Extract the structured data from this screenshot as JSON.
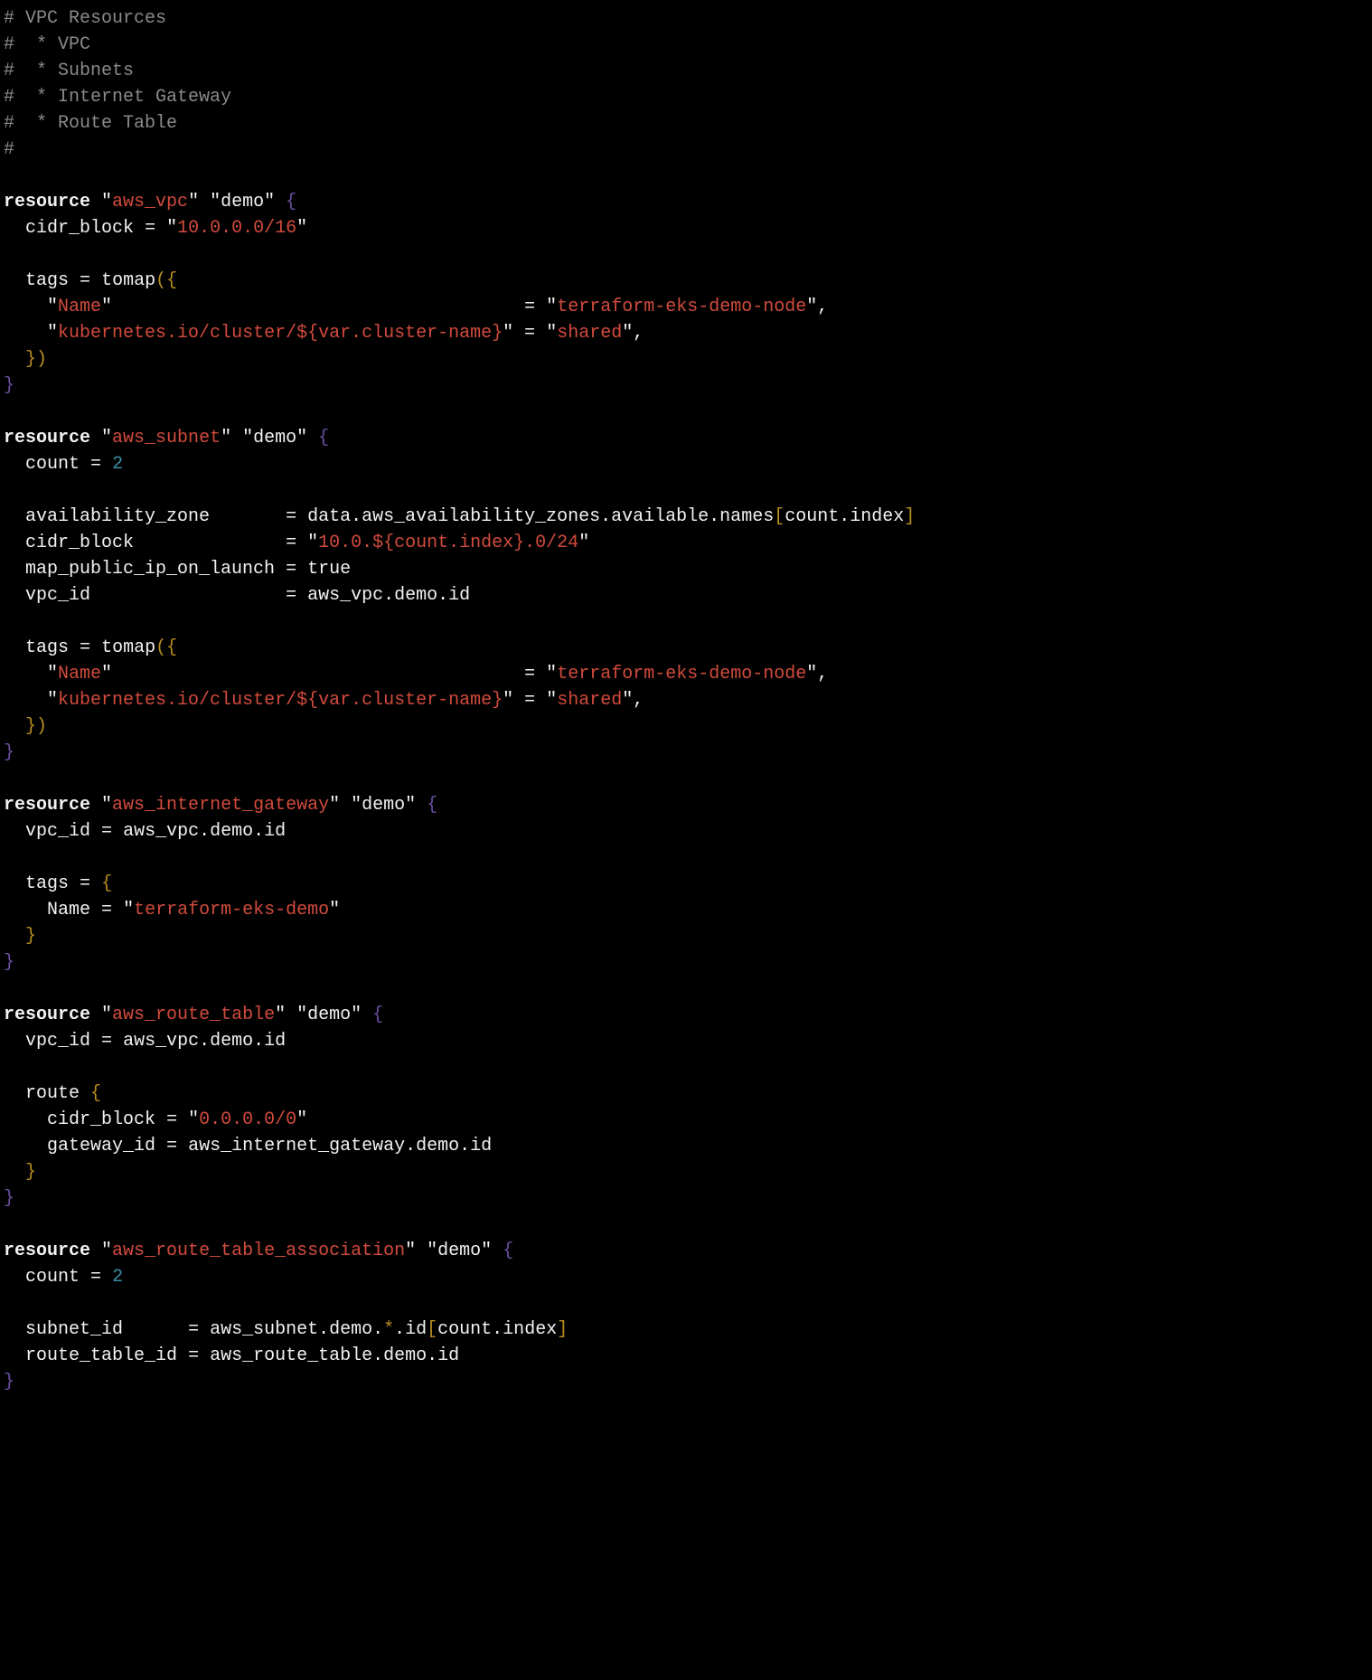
{
  "language": "hcl",
  "file_kind": "terraform",
  "comments": {
    "title": "# VPC Resources",
    "item_vpc": "#  * VPC",
    "item_subnets": "#  * Subnets",
    "item_igw": "#  * Internet Gateway",
    "item_rt": "#  * Route Table",
    "blank": "#"
  },
  "tokens": {
    "resource": "resource",
    "count": "count",
    "tags": "tags",
    "tomap": "tomap",
    "true": "true",
    "data": "data",
    "route": "route"
  },
  "resources": {
    "vpc": {
      "type": "aws_vpc",
      "name": "demo",
      "cidr_block_key": "cidr_block",
      "cidr_block_val": "10.0.0.0/16",
      "tag_name_key": "Name",
      "tag_name_val": "terraform-eks-demo-node",
      "tag_k8s_key_prefix": "kubernetes.io/cluster/",
      "tag_k8s_interp": "${var.cluster-name}",
      "tag_k8s_val": "shared"
    },
    "subnet": {
      "type": "aws_subnet",
      "name": "demo",
      "count_val": "2",
      "az_key": "availability_zone",
      "az_expr_prefix": "data.aws_availability_zones.available.names",
      "az_index": "count.index",
      "cidr_key": "cidr_block",
      "cidr_val_prefix": "10.0.",
      "cidr_val_interp": "${count.index}",
      "cidr_val_suffix": ".0/24",
      "mapip_key": "map_public_ip_on_launch",
      "vpcid_key": "vpc_id",
      "vpcid_expr": "aws_vpc.demo.id",
      "tag_name_key": "Name",
      "tag_name_val": "terraform-eks-demo-node",
      "tag_k8s_key_prefix": "kubernetes.io/cluster/",
      "tag_k8s_interp": "${var.cluster-name}",
      "tag_k8s_val": "shared"
    },
    "igw": {
      "type": "aws_internet_gateway",
      "name": "demo",
      "vpcid_key": "vpc_id",
      "vpcid_expr": "aws_vpc.demo.id",
      "tag_name_key": "Name",
      "tag_name_val": "terraform-eks-demo"
    },
    "rt": {
      "type": "aws_route_table",
      "name": "demo",
      "vpcid_key": "vpc_id",
      "vpcid_expr": "aws_vpc.demo.id",
      "route_cidr_key": "cidr_block",
      "route_cidr_val": "0.0.0.0/0",
      "route_gw_key": "gateway_id",
      "route_gw_expr": "aws_internet_gateway.demo.id"
    },
    "rta": {
      "type": "aws_route_table_association",
      "name": "demo",
      "count_val": "2",
      "subnet_key": "subnet_id",
      "subnet_expr_prefix": "aws_subnet.demo.",
      "subnet_expr_star": "*",
      "subnet_expr_suffix": ".id",
      "subnet_index": "count.index",
      "rt_key": "route_table_id",
      "rt_expr": "aws_route_table.demo.id"
    }
  }
}
